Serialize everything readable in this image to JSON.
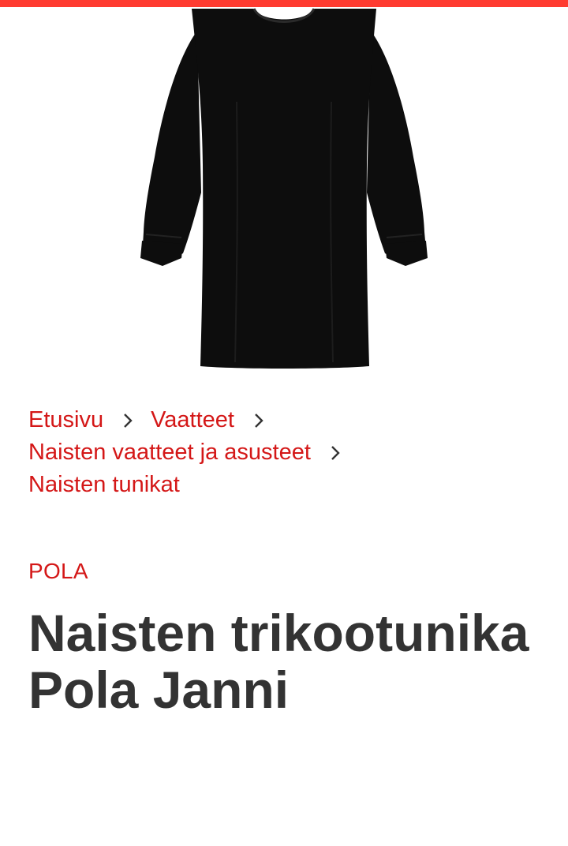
{
  "colors": {
    "accent": "#d41717",
    "top_bar": "#ff3b30",
    "title": "#333333",
    "garment": "#0d0d0d"
  },
  "product_image": {
    "icon": "black-tunic-dress-image"
  },
  "breadcrumb": {
    "items": [
      {
        "label": "Etusivu"
      },
      {
        "label": "Vaatteet"
      },
      {
        "label": "Naisten vaatteet ja asusteet"
      },
      {
        "label": "Naisten tunikat"
      }
    ]
  },
  "product": {
    "brand": "POLA",
    "title": "Naisten trikootunika Pola Janni"
  }
}
